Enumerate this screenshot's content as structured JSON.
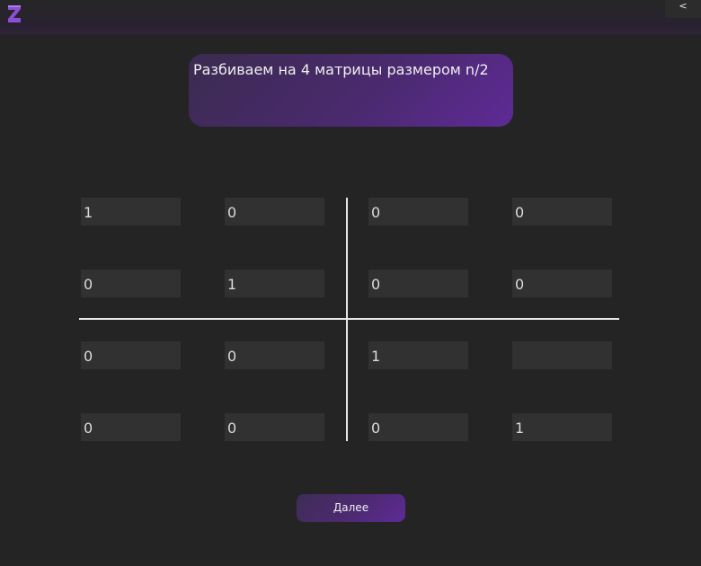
{
  "header": {
    "logo_icon": "z-logo-icon",
    "back_label": "<"
  },
  "banner": {
    "text": "Разбиваем на 4 матрицы размером n/2"
  },
  "matrix": {
    "rows": [
      [
        "1",
        "0",
        "0",
        "0"
      ],
      [
        "0",
        "1",
        "0",
        "0"
      ],
      [
        "0",
        "0",
        "1",
        ""
      ],
      [
        "0",
        "0",
        "0",
        "1"
      ]
    ]
  },
  "footer": {
    "next_label": "Далее"
  },
  "colors": {
    "background": "#242424",
    "cell": "#313131",
    "accent": "#5e2a96",
    "logo": "#8a4fd6"
  }
}
